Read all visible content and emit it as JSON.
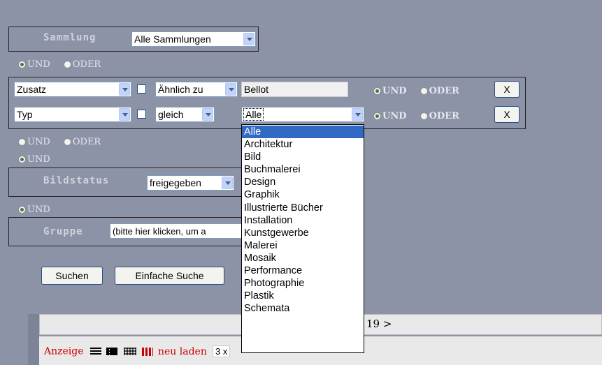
{
  "sammlung": {
    "label": "Sammlung",
    "value": "Alle Sammlungen"
  },
  "logic_row1": {
    "und": "UND",
    "oder": "ODER",
    "selected": "UND"
  },
  "criteria": [
    {
      "field": "Zusatz",
      "op": "Ähnlich zu",
      "value": "Bellot",
      "und": "UND",
      "oder": "ODER",
      "selected": "UND",
      "remove": "X"
    },
    {
      "field": "Typ",
      "op": "gleich",
      "value": "Alle",
      "und": "UND",
      "oder": "ODER",
      "selected": "UND",
      "remove": "X"
    }
  ],
  "logic_row2": {
    "und": "UND",
    "oder": "ODER",
    "selected": "UND"
  },
  "logic_row3": {
    "und": "UND"
  },
  "bildstatus": {
    "label": "Bildstatus",
    "value": "freigegeben"
  },
  "logic_row4": {
    "und": "UND"
  },
  "gruppe": {
    "label": "Gruppe",
    "value": "(bitte hier klicken, um a"
  },
  "buttons": {
    "search": "Suchen",
    "simple": "Einfache Suche"
  },
  "typ_dropdown": {
    "options": [
      "Alle",
      "Architektur",
      "Bild",
      "Buchmalerei",
      "Design",
      "Graphik",
      "Illustrierte Bücher",
      "Installation",
      "Kunstgewerbe",
      "Malerei",
      "Mosaik",
      "Performance",
      "Photographie",
      "Plastik",
      "Schemata"
    ],
    "selected": "Alle"
  },
  "pager": {
    "text": "19 >"
  },
  "footer": {
    "anzeige": "Anzeige",
    "neu_laden": "neu laden",
    "grid": "3 x"
  },
  "colors": {
    "background": "#8c93a7",
    "highlight": "#316ac5",
    "red_text": "#cc0000",
    "footer_bar": "#e9e9e9"
  }
}
